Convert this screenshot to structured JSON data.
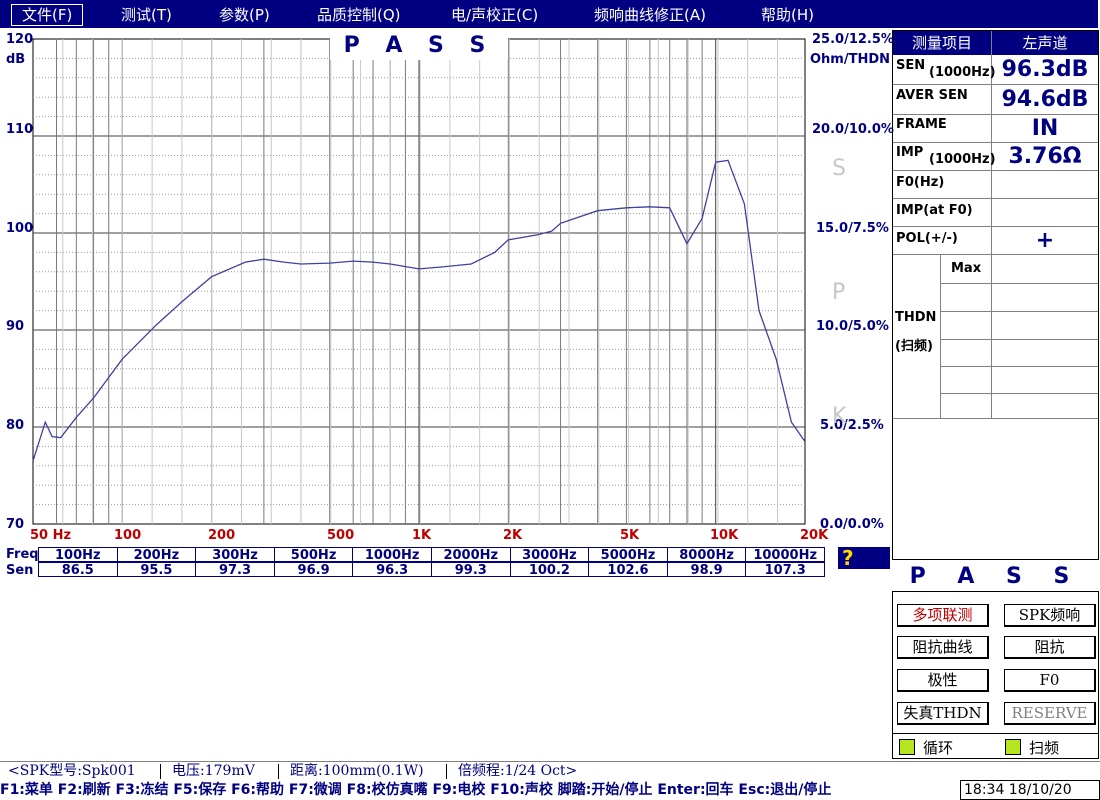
{
  "menu": [
    {
      "label": "文件(F)",
      "active": true
    },
    {
      "label": "测试(T)"
    },
    {
      "label": "参数(P)"
    },
    {
      "label": "品质控制(Q)"
    },
    {
      "label": "电/声校正(C)"
    },
    {
      "label": "频响曲线修正(A)"
    },
    {
      "label": "帮助(H)"
    }
  ],
  "plot": {
    "pass_label": "P A S S",
    "left_unit": "dB",
    "y_ticks": [
      "120",
      "110",
      "100",
      "90",
      "80",
      "70"
    ],
    "x_ticks": [
      "50 Hz",
      "100",
      "200",
      "500",
      "1K",
      "2K",
      "5K",
      "10K",
      "20K"
    ],
    "right_unit": "Ohm/THDN",
    "right_ticks": [
      "25.0/12.5%",
      "20.0/10.0%",
      "15.0/7.5%",
      "10.0/5.0%",
      "5.0/2.5%",
      "0.0/0.0%"
    ],
    "ghost_letters": [
      "S",
      "P",
      "K"
    ],
    "curve_color": "#4040a0"
  },
  "chart_data": {
    "type": "line",
    "xscale": "log",
    "xlim": [
      50,
      20000
    ],
    "ylim": [
      70,
      120
    ],
    "ylabel": "dB",
    "series": [
      {
        "x": [
          50,
          55,
          58,
          62,
          70,
          80,
          100,
          130,
          160,
          200,
          260,
          300,
          350,
          400,
          500,
          600,
          700,
          800,
          1000,
          1200,
          1500,
          1800,
          2000,
          2500,
          2800,
          3000,
          4000,
          5000,
          6000,
          7000,
          8000,
          9000,
          10000,
          11000,
          12500,
          14000,
          16000,
          18000,
          20000
        ],
        "y": [
          76.5,
          80.5,
          79.0,
          78.9,
          81.0,
          83.0,
          87.0,
          90.5,
          93.0,
          95.5,
          97.0,
          97.3,
          97.0,
          96.8,
          96.9,
          97.1,
          97.0,
          96.8,
          96.3,
          96.5,
          96.8,
          98.0,
          99.3,
          99.8,
          100.2,
          101.0,
          102.3,
          102.6,
          102.7,
          102.6,
          98.9,
          101.5,
          107.3,
          107.5,
          103.0,
          92.0,
          87.0,
          80.5,
          78.5
        ]
      }
    ]
  },
  "freq_table": {
    "row_labels": [
      "Freq",
      "Sen"
    ],
    "freqs": [
      "100Hz",
      "200Hz",
      "300Hz",
      "500Hz",
      "1000Hz",
      "2000Hz",
      "3000Hz",
      "5000Hz",
      "8000Hz",
      "10000Hz"
    ],
    "sens": [
      "86.5",
      "95.5",
      "97.3",
      "96.9",
      "96.3",
      "99.3",
      "100.2",
      "102.6",
      "98.9",
      "107.3"
    ]
  },
  "help_label": "?",
  "panel": {
    "header_left": "测量项目",
    "header_right": "左声道",
    "rows": [
      {
        "label": "SEN",
        "sub": "(1000Hz)",
        "value": "96.3dB"
      },
      {
        "label": "AVER SEN",
        "sub": "",
        "value": "94.6dB"
      },
      {
        "label": "FRAME",
        "sub": "",
        "value": "IN"
      },
      {
        "label": "IMP",
        "sub": "(1000Hz)",
        "value": "3.76Ω"
      },
      {
        "label": "F0(Hz)",
        "sub": "",
        "value": ""
      },
      {
        "label": "IMP(at F0)",
        "sub": "",
        "value": ""
      },
      {
        "label": "POL(+/-)",
        "sub": "",
        "value": "+"
      }
    ],
    "thdn_label1": "THDN",
    "thdn_label2": "(扫频)",
    "thdn_max": "Max"
  },
  "pass_right": "P A S S",
  "buttons": [
    {
      "label": "多项联测",
      "style": "red"
    },
    {
      "label": "SPK频响"
    },
    {
      "label": "阻抗曲线"
    },
    {
      "label": "阻抗"
    },
    {
      "label": "极性"
    },
    {
      "label": "F0"
    },
    {
      "label": "失真THDN"
    },
    {
      "label": "RESERVE",
      "style": "gray"
    }
  ],
  "toggles": [
    {
      "label": "循环",
      "color": "#b5e61d"
    },
    {
      "label": "扫频",
      "color": "#b5e61d"
    }
  ],
  "status": {
    "model": "<SPK型号:Spk001",
    "voltage": "电压:179mV",
    "distance": "距离:100mm(0.1W)",
    "octave": "倍频程:1/24 Oct>"
  },
  "fkeys": "F1:菜单 F2:刷新 F3:冻结 F5:保存 F6:帮助 F7:微调 F8:校仿真嘴 F9:电校 F10:声校 脚踏:开始/停止 Enter:回车 Esc:退出/停止",
  "clock": "18:34  18/10/20"
}
